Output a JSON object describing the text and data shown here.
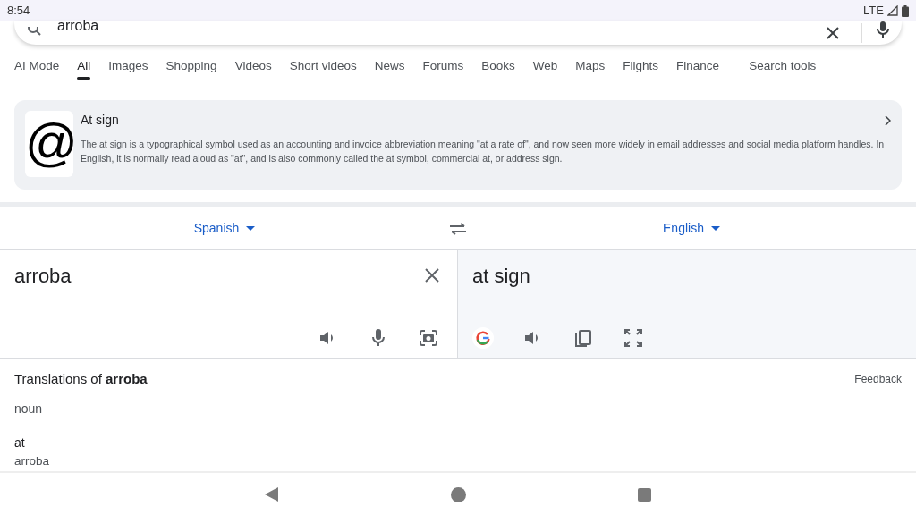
{
  "status_bar": {
    "time": "8:54",
    "network": "LTE"
  },
  "search": {
    "query": "arroba"
  },
  "tabs": [
    {
      "label": "AI Mode",
      "selected": false
    },
    {
      "label": "All",
      "selected": true
    },
    {
      "label": "Images",
      "selected": false
    },
    {
      "label": "Shopping",
      "selected": false
    },
    {
      "label": "Videos",
      "selected": false
    },
    {
      "label": "Short videos",
      "selected": false
    },
    {
      "label": "News",
      "selected": false
    },
    {
      "label": "Forums",
      "selected": false
    },
    {
      "label": "Books",
      "selected": false
    },
    {
      "label": "Web",
      "selected": false
    },
    {
      "label": "Maps",
      "selected": false
    },
    {
      "label": "Flights",
      "selected": false
    },
    {
      "label": "Finance",
      "selected": false
    }
  ],
  "search_tools": "Search tools",
  "knowledge_card": {
    "title": "At sign",
    "description": "The at sign is a typographical symbol used as an accounting and invoice abbreviation meaning \"at a rate of\", and now seen more widely in email addresses and social media platform handles. In English, it is normally read aloud as \"at\", and is also commonly called the at symbol, commercial at, or address sign.",
    "image_glyph": "@"
  },
  "translator": {
    "source_language": "Spanish",
    "target_language": "English",
    "source_text": "arroba",
    "translated_text": "at sign"
  },
  "translations": {
    "heading": "Translations of **arroba**",
    "feedback": "Feedback",
    "part_of_speech": "noun",
    "entries": [
      {
        "word": "at",
        "back_translation": "arroba"
      }
    ]
  }
}
